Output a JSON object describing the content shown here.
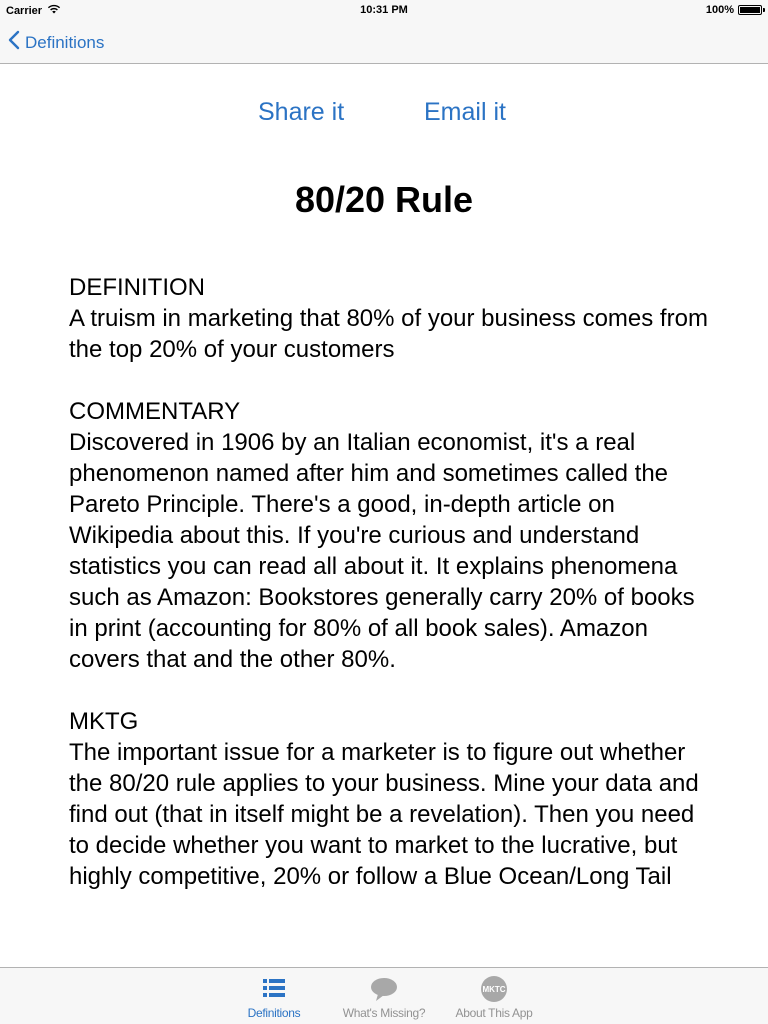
{
  "status_bar": {
    "carrier": "Carrier",
    "time": "10:31 PM",
    "battery": "100%",
    "battery_level": 1.0
  },
  "nav_bar": {
    "back_label": "Definitions"
  },
  "actions": {
    "share_label": "Share it",
    "email_label": "Email it"
  },
  "term": {
    "title": "80/20 Rule",
    "sections": [
      {
        "heading": "DEFINITION",
        "body": "A truism in marketing that 80% of your business comes from the top 20% of your customers"
      },
      {
        "heading": "COMMENTARY",
        "body": "Discovered in 1906 by an Italian economist, it's a real phenomenon named after him and sometimes called the Pareto Principle. There's a good, in-depth article on Wikipedia about this. If you're curious and understand statistics you can read all about it. It explains phenomena such as Amazon: Bookstores generally carry 20% of books in print (accounting for 80% of all book sales). Amazon covers that and the other 80%."
      },
      {
        "heading": "MKTG",
        "body": "The important issue for a marketer is to figure out whether the 80/20 rule applies to your business. Mine your data and find out (that in itself might be a revelation). Then you need to decide whether you want to market to the lucrative, but highly competitive, 20% or follow a Blue Ocean/Long Tail"
      }
    ]
  },
  "tab_bar": {
    "tabs": [
      {
        "label": "Definitions",
        "icon": "list-icon",
        "active": true
      },
      {
        "label": "What's Missing?",
        "icon": "speech-bubble-icon",
        "active": false
      },
      {
        "label": "About This App",
        "icon": "mktc-logo-icon",
        "active": false
      }
    ]
  },
  "colors": {
    "accent": "#2b73c4",
    "inactive": "#929292",
    "bar_background": "#f7f7f7"
  }
}
